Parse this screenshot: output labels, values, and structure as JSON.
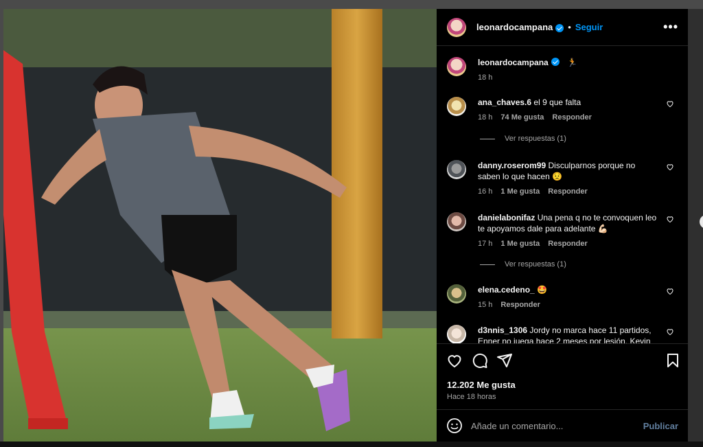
{
  "post": {
    "author": "leonardocampana",
    "follow_label": "Seguir",
    "separator": "•",
    "more_label": "•••",
    "caption_emoji": "🏃",
    "caption_time": "18 h",
    "likes": "12.202 Me gusta",
    "posted": "Hace 18 horas"
  },
  "comments": [
    {
      "user": "ana_chaves.6",
      "text": "el 9 que falta",
      "time": "18 h",
      "likes": "74 Me gusta",
      "reply": "Responder",
      "view_replies": "Ver respuestas (1)"
    },
    {
      "user": "danny.roserom99",
      "text": "Disculparnos porque no saben lo que hacen 😟",
      "time": "16 h",
      "likes": "1 Me gusta",
      "reply": "Responder"
    },
    {
      "user": "danielabonifaz",
      "text": "Una pena q no te convoquen leo te apoyamos dale para adelante 💪🏻",
      "time": "17 h",
      "likes": "1 Me gusta",
      "reply": "Responder",
      "view_replies": "Ver respuestas (1)"
    },
    {
      "user": "elena.cedeno_",
      "text": "🤩",
      "time": "15 h",
      "reply": "Responder"
    },
    {
      "user": "d3nnis_1306",
      "text": "Jordy no marca hace 11 partidos, Enner no juega hace 2 meses por lesión, Kevin"
    }
  ],
  "composer": {
    "placeholder": "Añade un comentario...",
    "post_label": "Publicar"
  },
  "colors": {
    "accent": "#0095f6",
    "panel_bg": "#000000",
    "muted_text": "#a8a8a8"
  },
  "icons": {
    "header_more": "more-horizontal-icon",
    "like": "heart-icon",
    "comment": "comment-icon",
    "share": "paper-plane-icon",
    "save": "bookmark-icon",
    "emoji": "emoji-icon"
  }
}
